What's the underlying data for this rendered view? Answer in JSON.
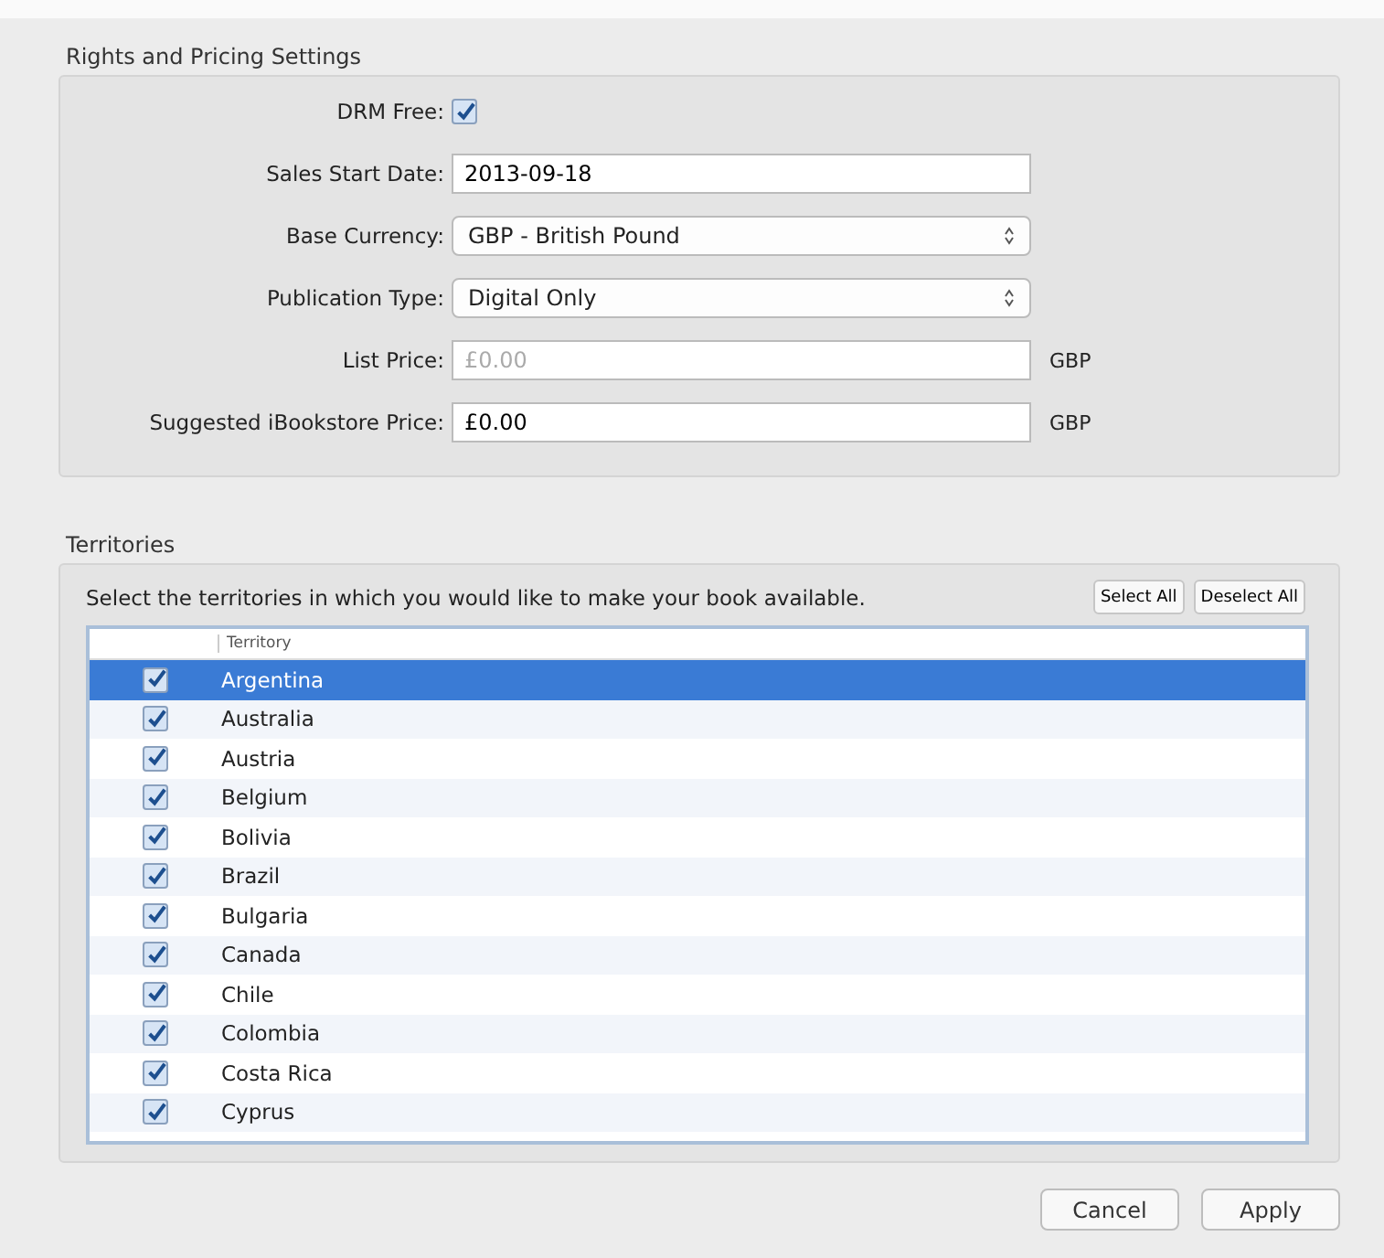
{
  "rights": {
    "title": "Rights and Pricing Settings",
    "drm_free": {
      "label": "DRM Free:",
      "checked": true
    },
    "fields": [
      {
        "kind": "text",
        "label": "Sales Start Date:",
        "value": "2013-09-18"
      },
      {
        "kind": "select",
        "label": "Base Currency:",
        "value": "GBP - British Pound"
      },
      {
        "kind": "select",
        "label": "Publication Type:",
        "value": "Digital Only"
      },
      {
        "kind": "text",
        "label": "List Price:",
        "placeholder": "£0.00",
        "unit": "GBP"
      },
      {
        "kind": "text",
        "label": "Suggested iBookstore Price:",
        "value": "£0.00",
        "unit": "GBP"
      }
    ]
  },
  "territories": {
    "title": "Territories",
    "instruction": "Select the territories in which you would like to make your book available.",
    "buttons": [
      "Select All",
      "Deselect All"
    ],
    "column": "Territory",
    "rows": [
      {
        "name": "Argentina",
        "checked": true,
        "selected": true
      },
      {
        "name": "Australia",
        "checked": true,
        "selected": false
      },
      {
        "name": "Austria",
        "checked": true,
        "selected": false
      },
      {
        "name": "Belgium",
        "checked": true,
        "selected": false
      },
      {
        "name": "Bolivia",
        "checked": true,
        "selected": false
      },
      {
        "name": "Brazil",
        "checked": true,
        "selected": false
      },
      {
        "name": "Bulgaria",
        "checked": true,
        "selected": false
      },
      {
        "name": "Canada",
        "checked": true,
        "selected": false
      },
      {
        "name": "Chile",
        "checked": true,
        "selected": false
      },
      {
        "name": "Colombia",
        "checked": true,
        "selected": false
      },
      {
        "name": "Costa Rica",
        "checked": true,
        "selected": false
      },
      {
        "name": "Cyprus",
        "checked": true,
        "selected": false
      }
    ]
  },
  "buttons": [
    "Cancel",
    "Apply"
  ]
}
